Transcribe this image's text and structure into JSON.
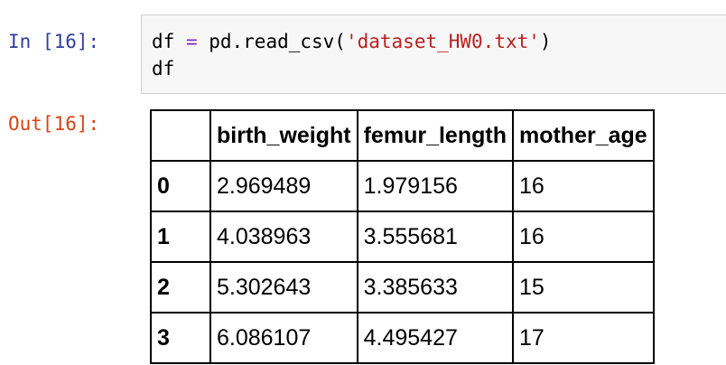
{
  "input_cell": {
    "prompt": "In [16]:",
    "code": {
      "line1": {
        "var": "df ",
        "op": "=",
        "call_open": " pd.read_csv(",
        "string": "'dataset_HW0.txt'",
        "call_close": ")"
      },
      "line2": "df"
    }
  },
  "output_cell": {
    "prompt": "Out[16]:",
    "table": {
      "index_header": "",
      "columns": [
        "birth_weight",
        "femur_length",
        "mother_age"
      ],
      "rows": [
        {
          "index": "0",
          "values": [
            "2.969489",
            "1.979156",
            "16"
          ]
        },
        {
          "index": "1",
          "values": [
            "4.038963",
            "3.555681",
            "16"
          ]
        },
        {
          "index": "2",
          "values": [
            "5.302643",
            "3.385633",
            "15"
          ]
        },
        {
          "index": "3",
          "values": [
            "6.086107",
            "4.495427",
            "17"
          ]
        }
      ]
    }
  }
}
